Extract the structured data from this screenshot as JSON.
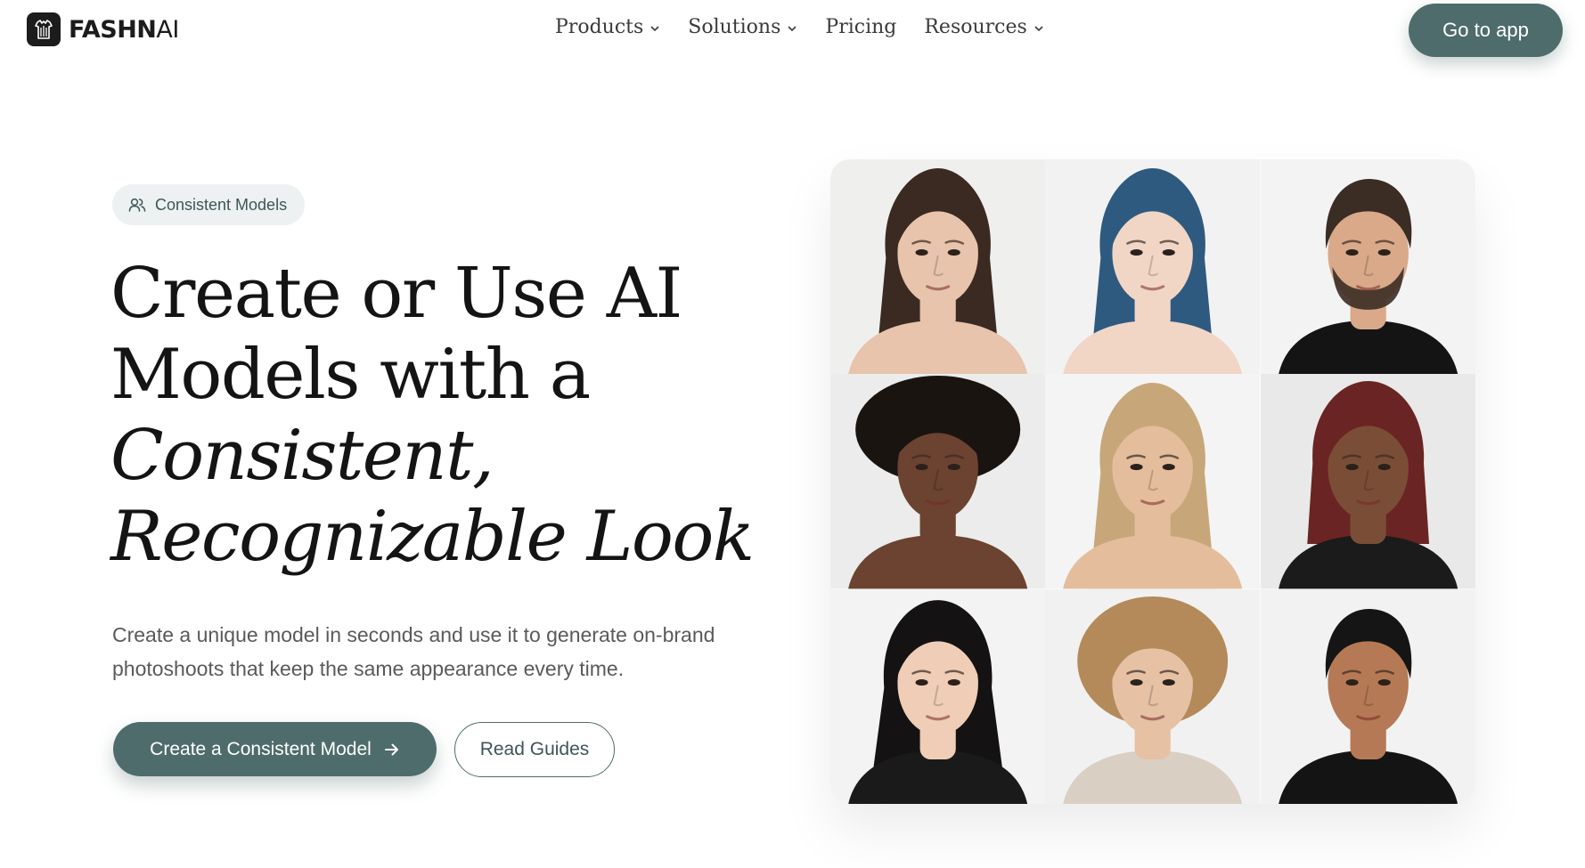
{
  "nav": {
    "logo_bold": "FASHN",
    "logo_light": "AI",
    "items": [
      {
        "label": "Products",
        "has_dropdown": true
      },
      {
        "label": "Solutions",
        "has_dropdown": true
      },
      {
        "label": "Pricing",
        "has_dropdown": false
      },
      {
        "label": "Resources",
        "has_dropdown": true
      }
    ],
    "cta_label": "Go to app"
  },
  "hero": {
    "badge_icon": "users-icon",
    "badge_label": "Consistent Models",
    "headline_line1": "Create or Use AI",
    "headline_line2": "Models with a",
    "headline_line3": "Consistent,",
    "headline_line4": "Recognizable Look",
    "subtext": "Create a unique model in seconds and use it to generate on-brand photoshoots that keep the same appearance every time.",
    "primary_cta": "Create a Consistent Model",
    "primary_cta_icon": "arrow-right-icon",
    "secondary_cta": "Read Guides"
  },
  "model_grid": [
    {
      "name": "model-portrait-1",
      "bg": "#efefee",
      "skin": "#e8c4ac",
      "hair": "#3a2a22",
      "hair_style": "long",
      "shirt": "#e8c4ac"
    },
    {
      "name": "model-portrait-2",
      "bg": "#f2f2f2",
      "skin": "#f1d6c6",
      "hair": "#2f5a80",
      "hair_style": "long",
      "shirt": "#f1d6c6"
    },
    {
      "name": "model-portrait-3",
      "bg": "#f3f3f3",
      "skin": "#d9a98a",
      "hair": "#3b2c24",
      "hair_style": "short-beard",
      "shirt": "#141414"
    },
    {
      "name": "model-portrait-4",
      "bg": "#ececec",
      "skin": "#6b4330",
      "hair": "#1a1411",
      "hair_style": "afro",
      "shirt": "#6b4330"
    },
    {
      "name": "model-portrait-5",
      "bg": "#f4f4f4",
      "skin": "#e4bd9c",
      "hair": "#c7a77a",
      "hair_style": "long",
      "shirt": "#e4bd9c"
    },
    {
      "name": "model-portrait-6",
      "bg": "#e9e9e9",
      "skin": "#7a4e36",
      "hair": "#6b2424",
      "hair_style": "bob",
      "shirt": "#1b1b1b"
    },
    {
      "name": "model-portrait-7",
      "bg": "#f3f3f3",
      "skin": "#efcdb6",
      "hair": "#141212",
      "hair_style": "medium",
      "shirt": "#1a1a1a"
    },
    {
      "name": "model-portrait-8",
      "bg": "#f1f1f1",
      "skin": "#e6c1a4",
      "hair": "#b48a5a",
      "hair_style": "curly",
      "shirt": "#d9cfc2"
    },
    {
      "name": "model-portrait-9",
      "bg": "#f2f2f2",
      "skin": "#b57a55",
      "hair": "#151515",
      "hair_style": "short",
      "shirt": "#141414"
    }
  ],
  "colors": {
    "accent": "#4e6c6b",
    "badge_bg": "#edf1f1",
    "text_dark": "#141414",
    "text_muted": "#5a5a5a"
  }
}
